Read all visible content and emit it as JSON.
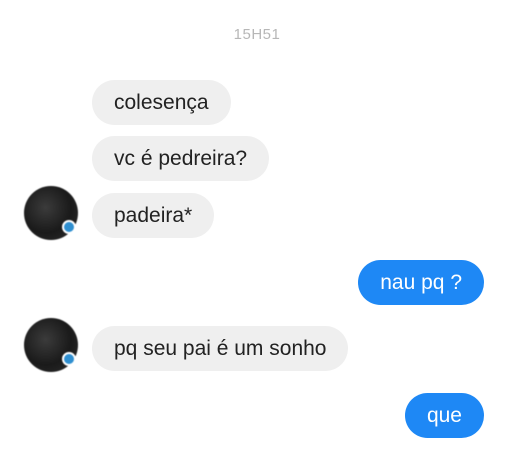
{
  "header": {
    "time": "15H51"
  },
  "messages": [
    {
      "from": "contact",
      "text": "colesença"
    },
    {
      "from": "contact",
      "text": "vc é pedreira?"
    },
    {
      "from": "contact",
      "text": "padeira*"
    },
    {
      "from": "me",
      "text": "nau pq ?"
    },
    {
      "from": "contact",
      "text": "pq seu pai é um sonho"
    },
    {
      "from": "me",
      "text": "que"
    }
  ],
  "colors": {
    "sent_bubble": "#1e88f5",
    "received_bubble": "#efefef",
    "timestamp": "#b7b7b7"
  }
}
